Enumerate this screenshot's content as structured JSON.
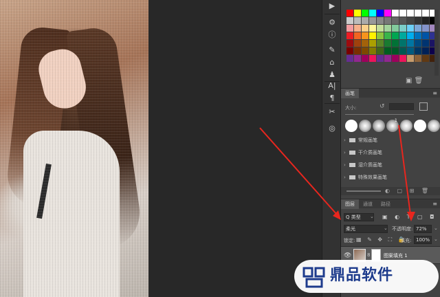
{
  "swatch_colors": [
    "#ff0000",
    "#ffff00",
    "#00ff00",
    "#00ffff",
    "#0000ff",
    "#ff00ff",
    "#ffffff",
    "#ffffff",
    "#ffffff",
    "#ffffff",
    "#ffffff",
    "#ffffff",
    "#cccccc",
    "#bbbbbb",
    "#aaaaaa",
    "#999999",
    "#888888",
    "#777777",
    "#666666",
    "#555555",
    "#444444",
    "#333333",
    "#222222",
    "#000000",
    "#f29ca0",
    "#f6b08b",
    "#fbd08b",
    "#fff799",
    "#c4df9b",
    "#a3d39c",
    "#82ca9c",
    "#7bcdc8",
    "#6dcff6",
    "#7da7d9",
    "#8493ca",
    "#a186be",
    "#ed1c24",
    "#f26522",
    "#f7941d",
    "#fff200",
    "#8dc63f",
    "#39b54a",
    "#00a651",
    "#00a99d",
    "#00aeef",
    "#0072bc",
    "#0054a6",
    "#2e3192",
    "#9e0b0f",
    "#a0410d",
    "#a3620a",
    "#aba000",
    "#598527",
    "#197b30",
    "#007236",
    "#00746b",
    "#0076a3",
    "#004a80",
    "#003471",
    "#1b1464",
    "#790000",
    "#7b2e00",
    "#7d4900",
    "#827b00",
    "#406618",
    "#005e20",
    "#005826",
    "#005952",
    "#005b7f",
    "#003663",
    "#002157",
    "#0d004c",
    "#662d91",
    "#92278f",
    "#9e005d",
    "#ed145b",
    "#662d91",
    "#92278f",
    "#9e005d",
    "#ed145b",
    "#c69c6d",
    "#8c6239",
    "#603913",
    "#42210b"
  ],
  "tools": {
    "play_icon": "▶",
    "t1": "⚙",
    "t2": "ⓘ",
    "t3": "✎",
    "t4": "⌂",
    "t5": "♟",
    "t6": "A|",
    "t7": "¶",
    "t8": "✂",
    "t9": "◎"
  },
  "brush_panel": {
    "tab_label": "画笔",
    "menu_icon": "≡",
    "size_label": "大小:",
    "reset_icon": "↺",
    "presets": [
      {
        "num": "",
        "color": "#ffffff"
      },
      {
        "num": "",
        "color": "#c8c8c8"
      },
      {
        "num": "",
        "color": "#bdbdbd"
      },
      {
        "num": "1",
        "color": "#bbbbbb"
      },
      {
        "num": "",
        "color": "#d0d0d0"
      },
      {
        "num": "",
        "color": "#ffffff"
      },
      {
        "num": "",
        "color": "#cfcfcf"
      }
    ],
    "folders": [
      "常规画笔",
      "干介质画笔",
      "湿介质画笔",
      "特殊效果画笔"
    ],
    "bottom_icons": "◐ ▢ ⊞ 🗑"
  },
  "layers_panel": {
    "tabs": [
      "图层",
      "通道",
      "路径"
    ],
    "filter_label": "Q 类型",
    "filter_icons": "▣ ◐ T ▢ ◘",
    "blend_mode": "柔光",
    "opacity_label": "不透明度:",
    "opacity_value": "72%",
    "lock_label": "锁定:",
    "lock_icons": "▦ ✎ ✥ ⛶ 🔒",
    "fill_label": "填充:",
    "fill_value": "100%",
    "eye_icon": "👁",
    "link_icon": "8",
    "layer_name": "图案填充 1"
  },
  "watermark": {
    "text": "鼎品软件"
  }
}
